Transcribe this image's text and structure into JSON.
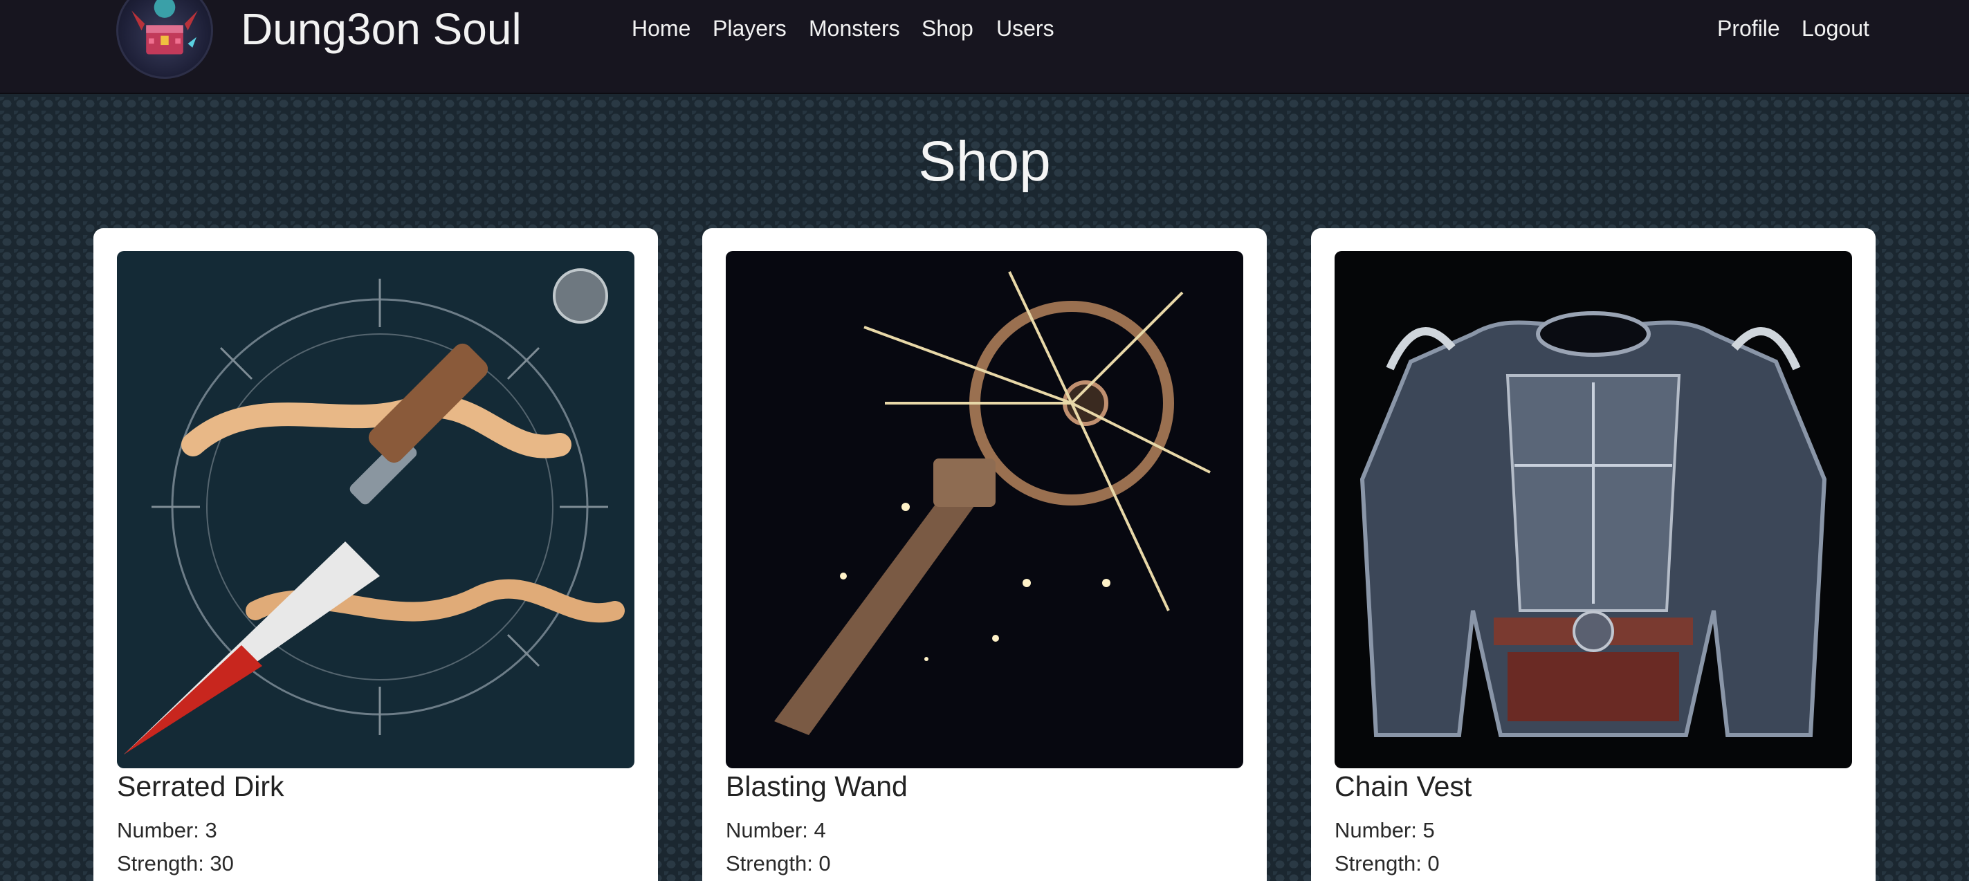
{
  "navbar": {
    "brand": "Dung3on Soul",
    "links": [
      "Home",
      "Players",
      "Monsters",
      "Shop",
      "Users"
    ],
    "right_links": [
      "Profile",
      "Logout"
    ]
  },
  "page": {
    "title": "Shop"
  },
  "items": [
    {
      "name": "Serrated Dirk",
      "number_label": "Number: 3",
      "strength_label": "Strength: 30",
      "image_icon": "dagger-icon"
    },
    {
      "name": "Blasting Wand",
      "number_label": "Number: 4",
      "strength_label": "Strength: 0",
      "image_icon": "wand-icon"
    },
    {
      "name": "Chain Vest",
      "number_label": "Number: 5",
      "strength_label": "Strength: 0",
      "image_icon": "armor-icon"
    }
  ],
  "colors": {
    "navbar_bg": "#17151f",
    "page_bg": "#1b2730",
    "card_bg": "#ffffff"
  }
}
